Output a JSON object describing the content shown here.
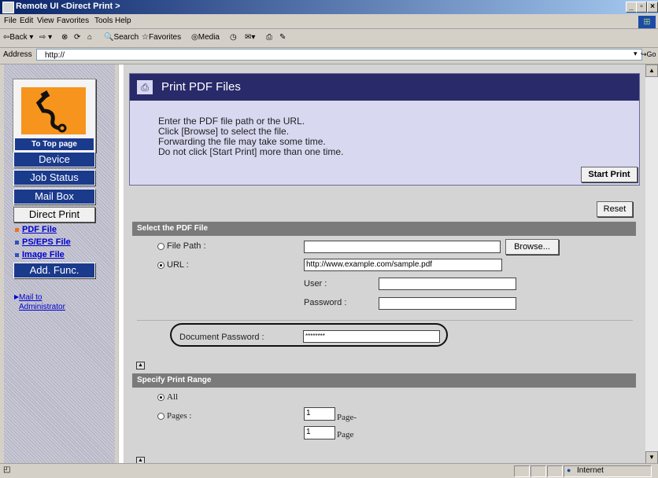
{
  "window": {
    "title": "Remote UI <Direct Print >",
    "min": "_",
    "max": "▫",
    "close": "×"
  },
  "menu": [
    "File",
    "Edit",
    "View",
    "Favorites",
    "Tools",
    "Help"
  ],
  "toolbar": {
    "back": "⇦Back",
    "forward": "⇨",
    "search": "Search",
    "favorites": "Favorites",
    "media": "Media"
  },
  "address": {
    "label": "Address",
    "value": "http://",
    "go": "Go"
  },
  "sidebar": {
    "top_label": "To Top page",
    "buttons": [
      "Device",
      "Job Status",
      "Mail Box",
      "Direct Print"
    ],
    "sub_links": [
      "PDF File",
      "PS/EPS File",
      "Image File"
    ],
    "add_func": "Add. Func.",
    "mail_line1": "Mail to",
    "mail_line2": "Administrator"
  },
  "panel": {
    "title": "Print PDF Files",
    "instructions": [
      "Enter the PDF file path or the URL.",
      "Click [Browse] to select the file.",
      "Forwarding the file may take some time.",
      "Do not click [Start Print] more than one time."
    ],
    "start_print": "Start Print"
  },
  "reset": "Reset",
  "select_pdf": {
    "heading": "Select the PDF File",
    "file_path_label": "File Path :",
    "browse": "Browse...",
    "url_label": "URL :",
    "url_value": "http://www.example.com/sample.pdf",
    "user_label": "User :",
    "password_label": "Password :",
    "doc_password_label": "Document Password :",
    "doc_password_value": "********"
  },
  "print_range": {
    "heading": "Specify Print Range",
    "all_label": "All",
    "pages_label": "Pages :",
    "from_value": "1",
    "from_suffix": "Page-",
    "to_value": "1",
    "to_suffix": "Page"
  },
  "status": {
    "zone": "Internet"
  },
  "colors": {
    "accent_blue": "#1a3a8c",
    "panel_header": "#292a6a",
    "section_bar": "#7a7a7a",
    "logo_orange": "#f7941d"
  }
}
